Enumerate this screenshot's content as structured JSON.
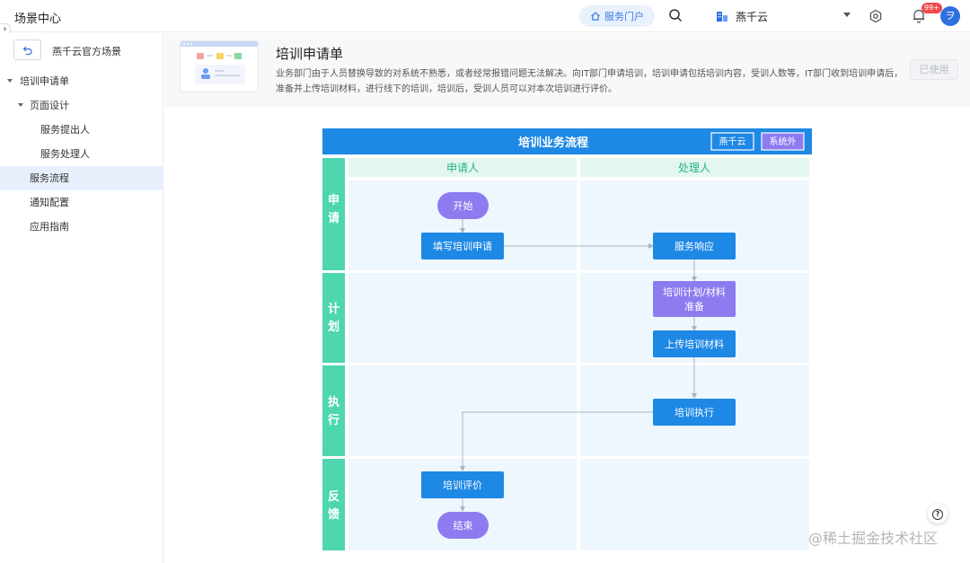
{
  "topbar": {
    "app_title": "场景中心",
    "portal_label": "服务门户",
    "org_name": "燕千云",
    "badge": "99+",
    "avatar_letter": "ヲ"
  },
  "sidebar": {
    "toggle": "›",
    "scene_name": "燕千云官方场景",
    "tree": [
      {
        "label": "培训申请单"
      },
      {
        "label": "页面设计"
      },
      {
        "label": "服务提出人"
      },
      {
        "label": "服务处理人"
      },
      {
        "label": "服务流程"
      },
      {
        "label": "通知配置"
      },
      {
        "label": "应用指南"
      }
    ]
  },
  "header": {
    "title": "培训申请单",
    "description": "业务部门由于人员替换导致的对系统不熟悉，或者经常报错问题无法解决。向IT部门申请培训，培训申请包括培训内容，受训人数等，IT部门收到培训申请后，准备并上传培训材料，进行线下的培训，培训后，受训人员可以对本次培训进行评价。",
    "used_label": "已使用"
  },
  "flowchart": {
    "title": "培训业务流程",
    "tag_a": "燕千云",
    "tag_b": "系统外",
    "col_applicant": "申请人",
    "col_handler": "处理人",
    "phases": [
      "申\n请",
      "计\n划",
      "执\n行",
      "反\n馈"
    ],
    "nodes": {
      "start": "开始",
      "fill_request": "填写培训申请",
      "service_response": "服务响应",
      "plan_line1": "培训计划/材料",
      "plan_line2": "准备",
      "upload": "上传培训材料",
      "execute": "培训执行",
      "evaluate": "培训评价",
      "end": "结束"
    },
    "colors": {
      "header_blue": "#1e88e5",
      "phase_green": "#4dd6b0",
      "col_header_bg": "#e3f6ef",
      "col_header_text": "#27b37f",
      "lane_bg": "#eef6fe",
      "node_blue": "#1e88e5",
      "node_purple": "#8c7cf0"
    }
  },
  "help": "?",
  "watermark": "@稀土掘金技术社区"
}
